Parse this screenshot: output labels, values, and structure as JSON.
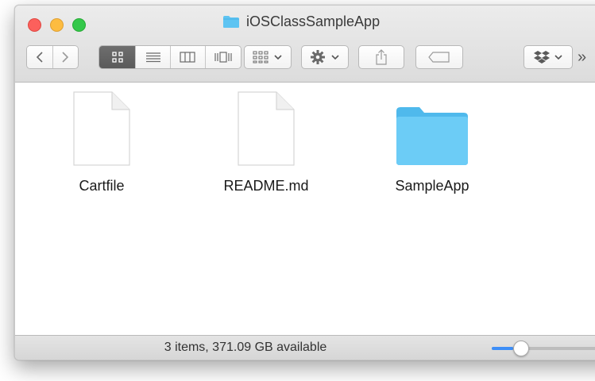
{
  "window": {
    "title": "iOSClassSampleApp"
  },
  "toolbar": {
    "back_icon": "chevron-left-icon",
    "forward_icon": "chevron-right-icon",
    "view_modes": [
      "icon-view",
      "list-view",
      "column-view",
      "cover-flow-view"
    ],
    "active_view": "icon-view",
    "arrange_icon": "arrange-grid-icon",
    "action_icon": "gear-icon",
    "share_icon": "share-icon",
    "tags_icon": "tag-icon",
    "dropbox_icon": "dropbox-icon",
    "overflow_label": "»"
  },
  "files": [
    {
      "name": "Cartfile",
      "type": "document"
    },
    {
      "name": "README.md",
      "type": "document"
    },
    {
      "name": "SampleApp",
      "type": "folder"
    }
  ],
  "status": {
    "text": "3 items, 371.09 GB available",
    "icon_size_fraction": 0.18
  },
  "colors": {
    "close": "#fc605c",
    "minimize": "#fdbc40",
    "zoom": "#34c84a",
    "folder": "#5ec4f2",
    "slider_accent": "#3d8ef7"
  }
}
